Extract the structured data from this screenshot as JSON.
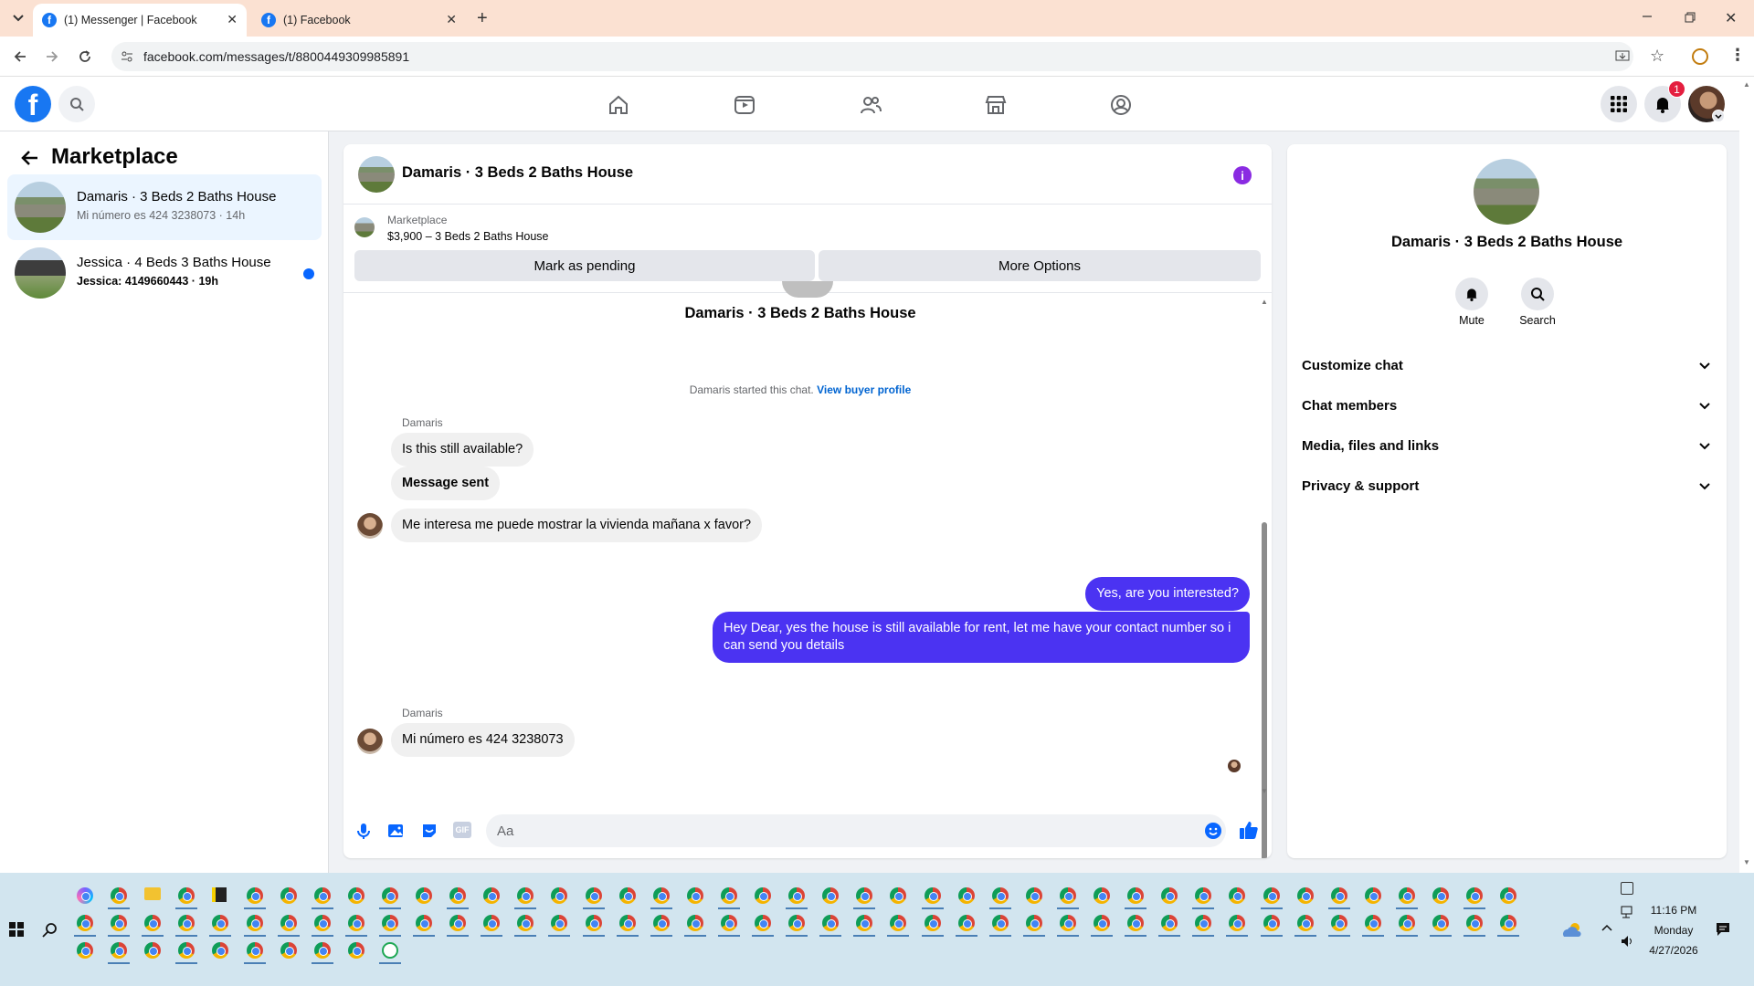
{
  "browser": {
    "tabs": [
      {
        "title": "(1) Messenger | Facebook",
        "active": true
      },
      {
        "title": "(1) Facebook",
        "active": false
      }
    ],
    "url": "facebook.com/messages/t/8800449309985891"
  },
  "header": {
    "notification_count": "1",
    "colors": {
      "brand": "#1877f2",
      "badge": "#e41e3f"
    }
  },
  "sidebar": {
    "title": "Marketplace",
    "conversations": [
      {
        "name": "Damaris · 3 Beds 2 Baths House",
        "preview": "Mi número es 424 3238073 · 14h",
        "unread": false,
        "selected": true
      },
      {
        "name": "Jessica · 4 Beds 3 Baths House",
        "preview": "Jessica: 4149660443 · 19h",
        "unread": true,
        "selected": false
      }
    ]
  },
  "chat": {
    "title": "Damaris · 3 Beds 2 Baths House",
    "listing": {
      "source": "Marketplace",
      "detail": "$3,900 – 3 Beds 2 Baths House",
      "mark_pending": "Mark as pending",
      "more_options": "More Options"
    },
    "intro_name": "Damaris · 3 Beds 2 Baths House",
    "started_text": "Damaris started this chat.",
    "view_profile": "View buyer profile",
    "messages": [
      {
        "sender_label": "Damaris",
        "text": "Is this still available?",
        "from_me": false
      },
      {
        "text": "Message sent",
        "from_me": false
      },
      {
        "text": "Me interesa  me puede mostrar la vivienda mañana x favor?",
        "from_me": false
      },
      {
        "text": "Yes, are you interested?",
        "from_me": true
      },
      {
        "text": "Hey Dear, yes the house is still available for rent, let me have your contact number so i can send you details",
        "from_me": true
      },
      {
        "sender_label": "Damaris",
        "text": "Mi número es 424 3238073",
        "from_me": false
      }
    ],
    "composer_placeholder": "Aa",
    "colors": {
      "outgoing": "#4b33f2",
      "link": "#0064d1"
    }
  },
  "details": {
    "name": "Damaris · 3 Beds 2 Baths House",
    "mute_label": "Mute",
    "search_label": "Search",
    "sections": [
      "Customize chat",
      "Chat members",
      "Media, files and links",
      "Privacy & support"
    ]
  },
  "taskbar": {
    "time": "11:16 PM",
    "day": "Monday",
    "date": "4/27/2026"
  }
}
